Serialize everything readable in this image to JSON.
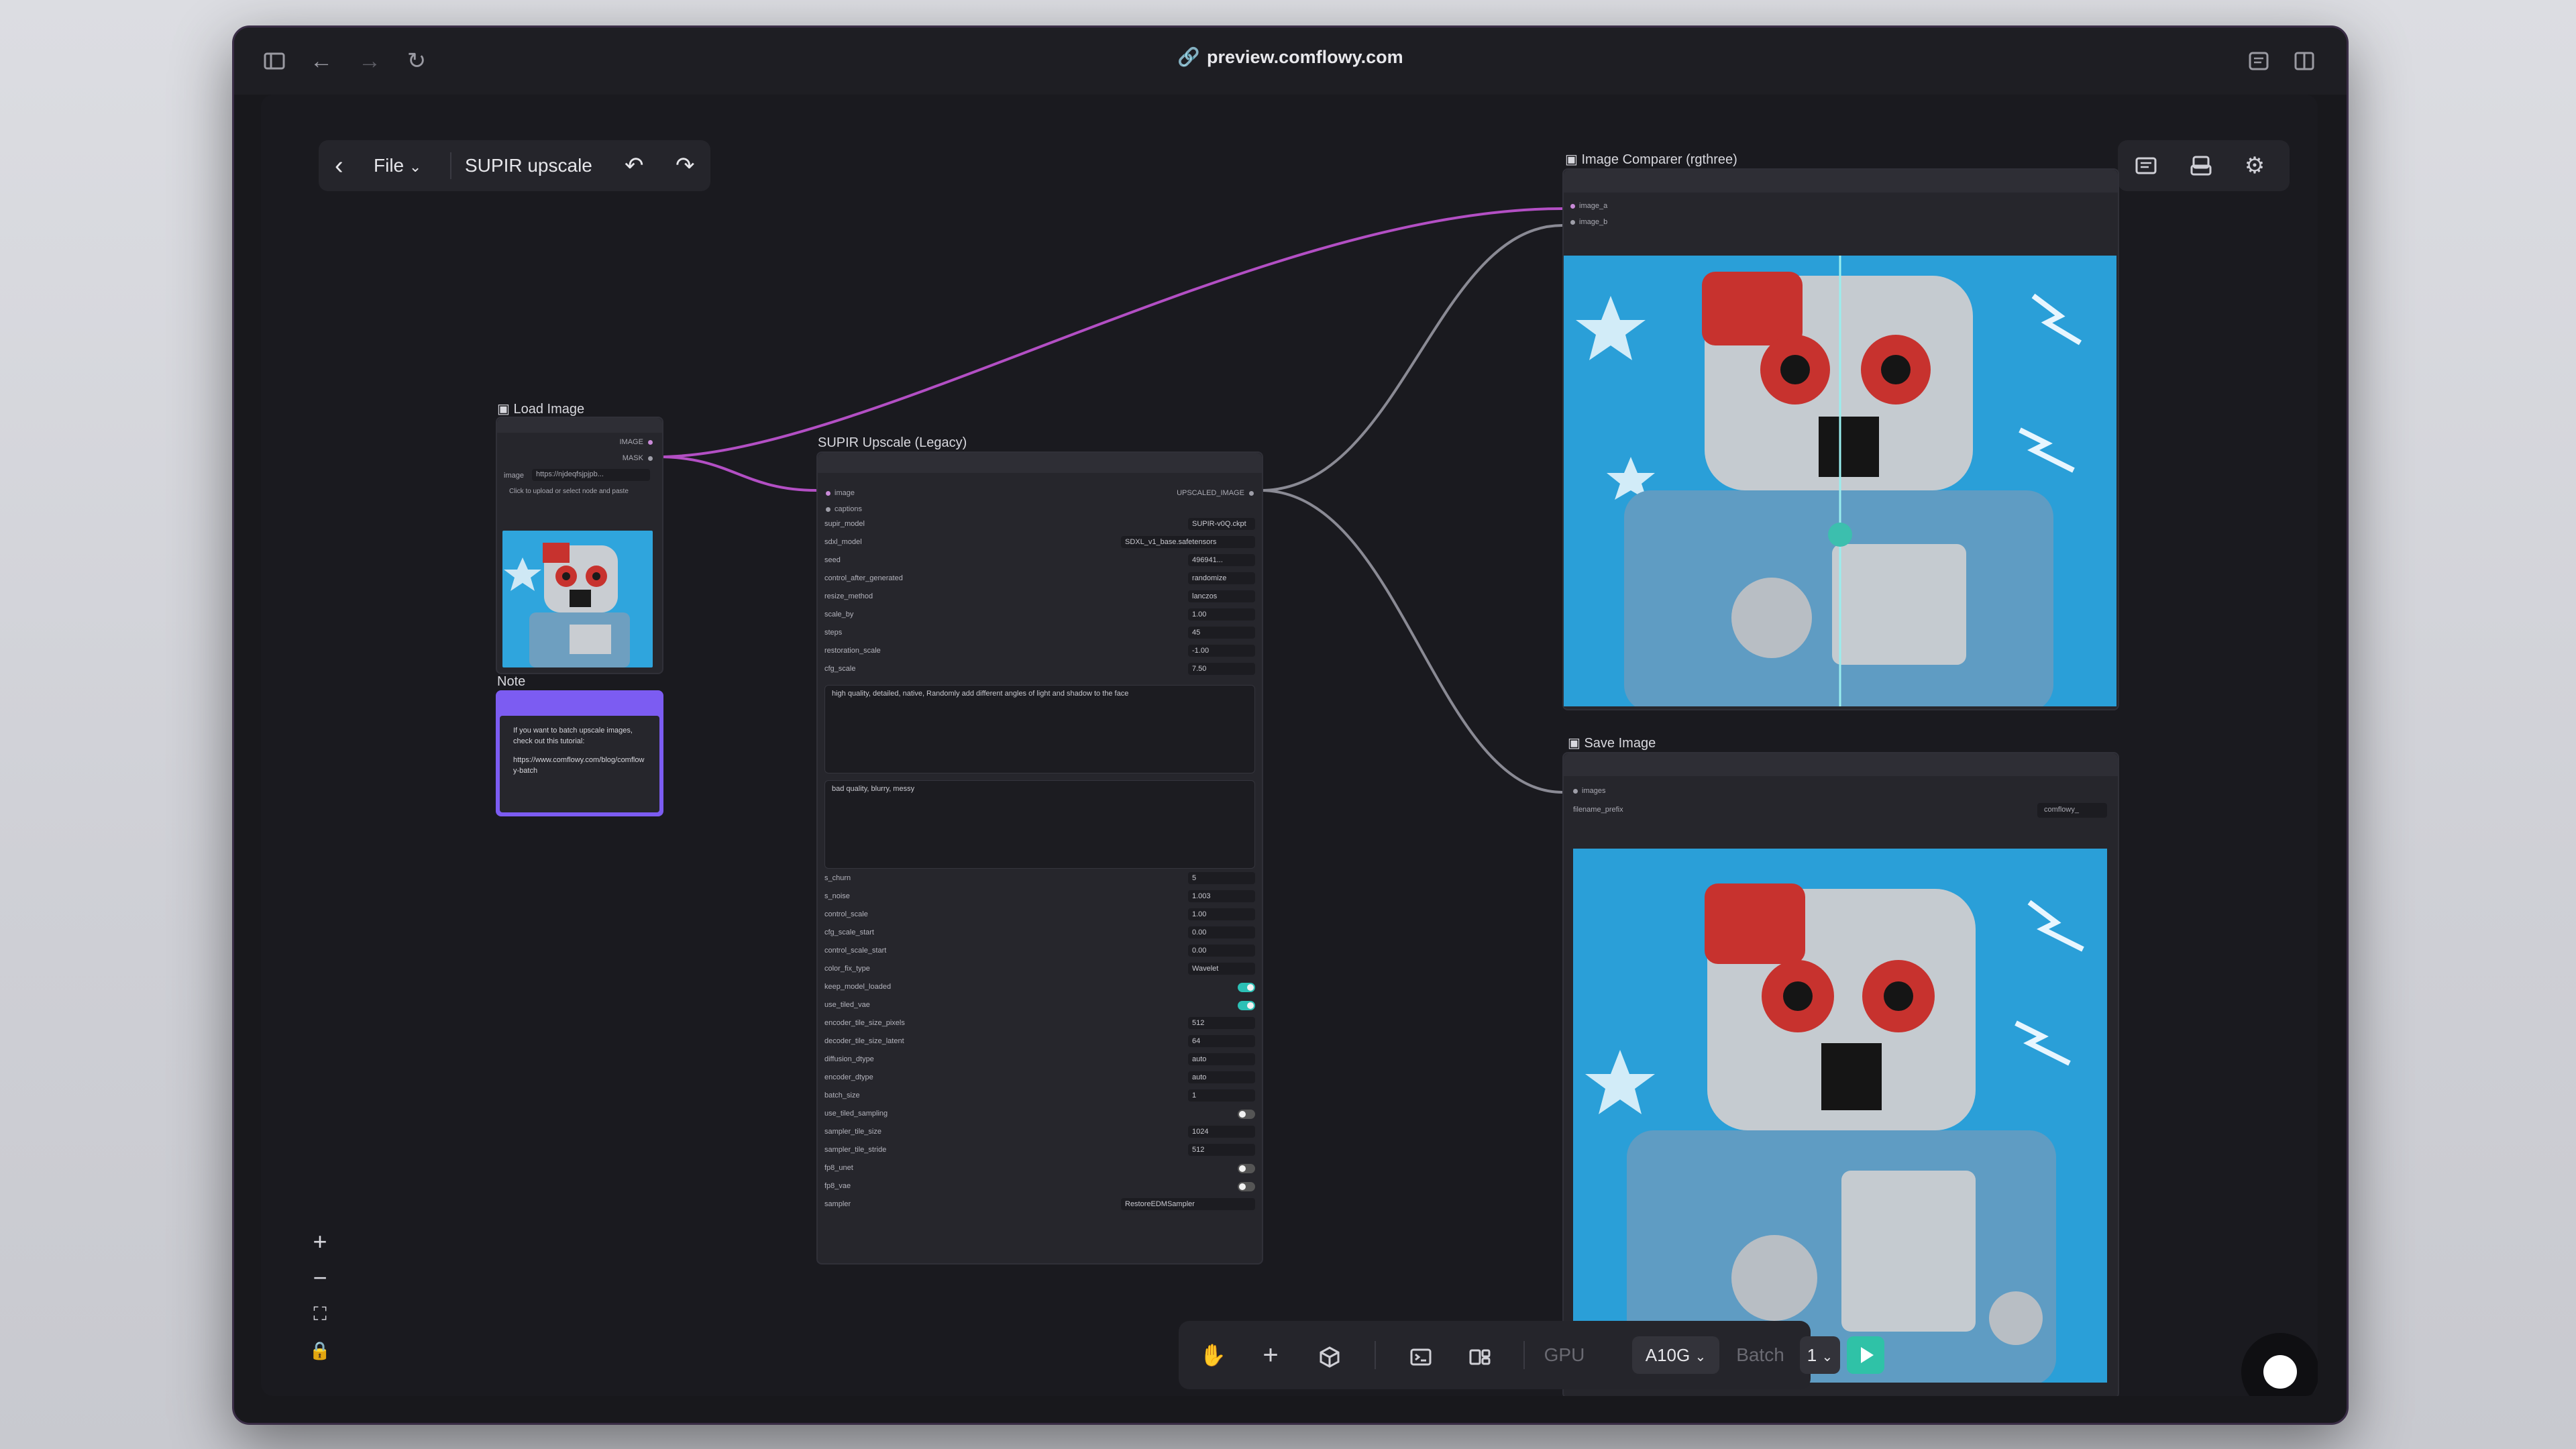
{
  "browser": {
    "url": "preview.comflowy.com",
    "icons": [
      "sidebar-icon",
      "back-arrow-icon",
      "forward-arrow-icon",
      "reload-icon",
      "link-icon",
      "reader-icon",
      "split-view-icon"
    ]
  },
  "toolbar": {
    "file_label": "File",
    "title": "SUPIR upscale"
  },
  "nodes": {
    "load_image": {
      "title": "Load Image",
      "output_image": "IMAGE",
      "output_mask": "MASK",
      "image_label": "image",
      "image_value": "https://njdeqfsjpjpb...",
      "upload_hint": "Click to upload or select node and paste"
    },
    "note": {
      "title": "Note",
      "text_line1": "If you want to batch upscale images, check out this tutorial:",
      "text_line2": "https://www.comflowy.com/blog/comflowy-batch",
      "color": "#7c5cf2"
    },
    "supir": {
      "title": "SUPIR Upscale (Legacy)",
      "input_image": "image",
      "input_captions": "captions",
      "output": "UPSCALED_IMAGE",
      "params": [
        {
          "label": "supir_model",
          "value": "SUPIR-v0Q.ckpt"
        },
        {
          "label": "sdxl_model",
          "value": "SDXL_v1_base.safetensors"
        },
        {
          "label": "seed",
          "value": "496941..."
        },
        {
          "label": "control_after_generated",
          "value": "randomize"
        },
        {
          "label": "resize_method",
          "value": "lanczos"
        },
        {
          "label": "scale_by",
          "value": "1.00"
        },
        {
          "label": "steps",
          "value": "45"
        },
        {
          "label": "restoration_scale",
          "value": "-1.00"
        },
        {
          "label": "cfg_scale",
          "value": "7.50"
        }
      ],
      "positive_prompt": "high quality, detailed,  native,  Randomly add different angles of light and shadow to the face",
      "negative_prompt": "bad quality, blurry, messy",
      "params2": [
        {
          "label": "s_churn",
          "value": "5"
        },
        {
          "label": "s_noise",
          "value": "1.003"
        },
        {
          "label": "control_scale",
          "value": "1.00"
        },
        {
          "label": "cfg_scale_start",
          "value": "0.00"
        },
        {
          "label": "control_scale_start",
          "value": "0.00"
        },
        {
          "label": "color_fix_type",
          "value": "Wavelet"
        },
        {
          "label": "keep_model_loaded",
          "toggle": true
        },
        {
          "label": "use_tiled_vae",
          "toggle": true
        },
        {
          "label": "encoder_tile_size_pixels",
          "value": "512"
        },
        {
          "label": "decoder_tile_size_latent",
          "value": "64"
        },
        {
          "label": "diffusion_dtype",
          "value": "auto"
        },
        {
          "label": "encoder_dtype",
          "value": "auto"
        },
        {
          "label": "batch_size",
          "value": "1"
        },
        {
          "label": "use_tiled_sampling",
          "toggle": false
        },
        {
          "label": "sampler_tile_size",
          "value": "1024"
        },
        {
          "label": "sampler_tile_stride",
          "value": "512"
        },
        {
          "label": "fp8_unet",
          "toggle": false
        },
        {
          "label": "fp8_vae",
          "toggle": false
        },
        {
          "label": "sampler",
          "value": "RestoreEDMSampler"
        }
      ]
    },
    "comparer": {
      "title": "Image Comparer (rgthree)",
      "input_a": "image_a",
      "input_b": "image_b"
    },
    "save": {
      "title": "Save Image",
      "input_images": "images",
      "prefix_label": "filename_prefix",
      "prefix_value": "comflowy_"
    }
  },
  "bottombar": {
    "gpu_label": "GPU",
    "gpu_value": "A10G",
    "batch_label": "Batch",
    "batch_value": "1",
    "icons": [
      "hand-icon",
      "plus-icon",
      "cube-icon",
      "terminal-icon",
      "layout-icon",
      "run-icon"
    ]
  },
  "zoom_controls": [
    "zoom-in",
    "zoom-out",
    "fit-view",
    "lock"
  ],
  "colors": {
    "wire_purple": "#b34fc4",
    "wire_gray": "#8a8a94",
    "accent_teal": "#2fc2a7",
    "note_purple": "#7c5cf2"
  }
}
